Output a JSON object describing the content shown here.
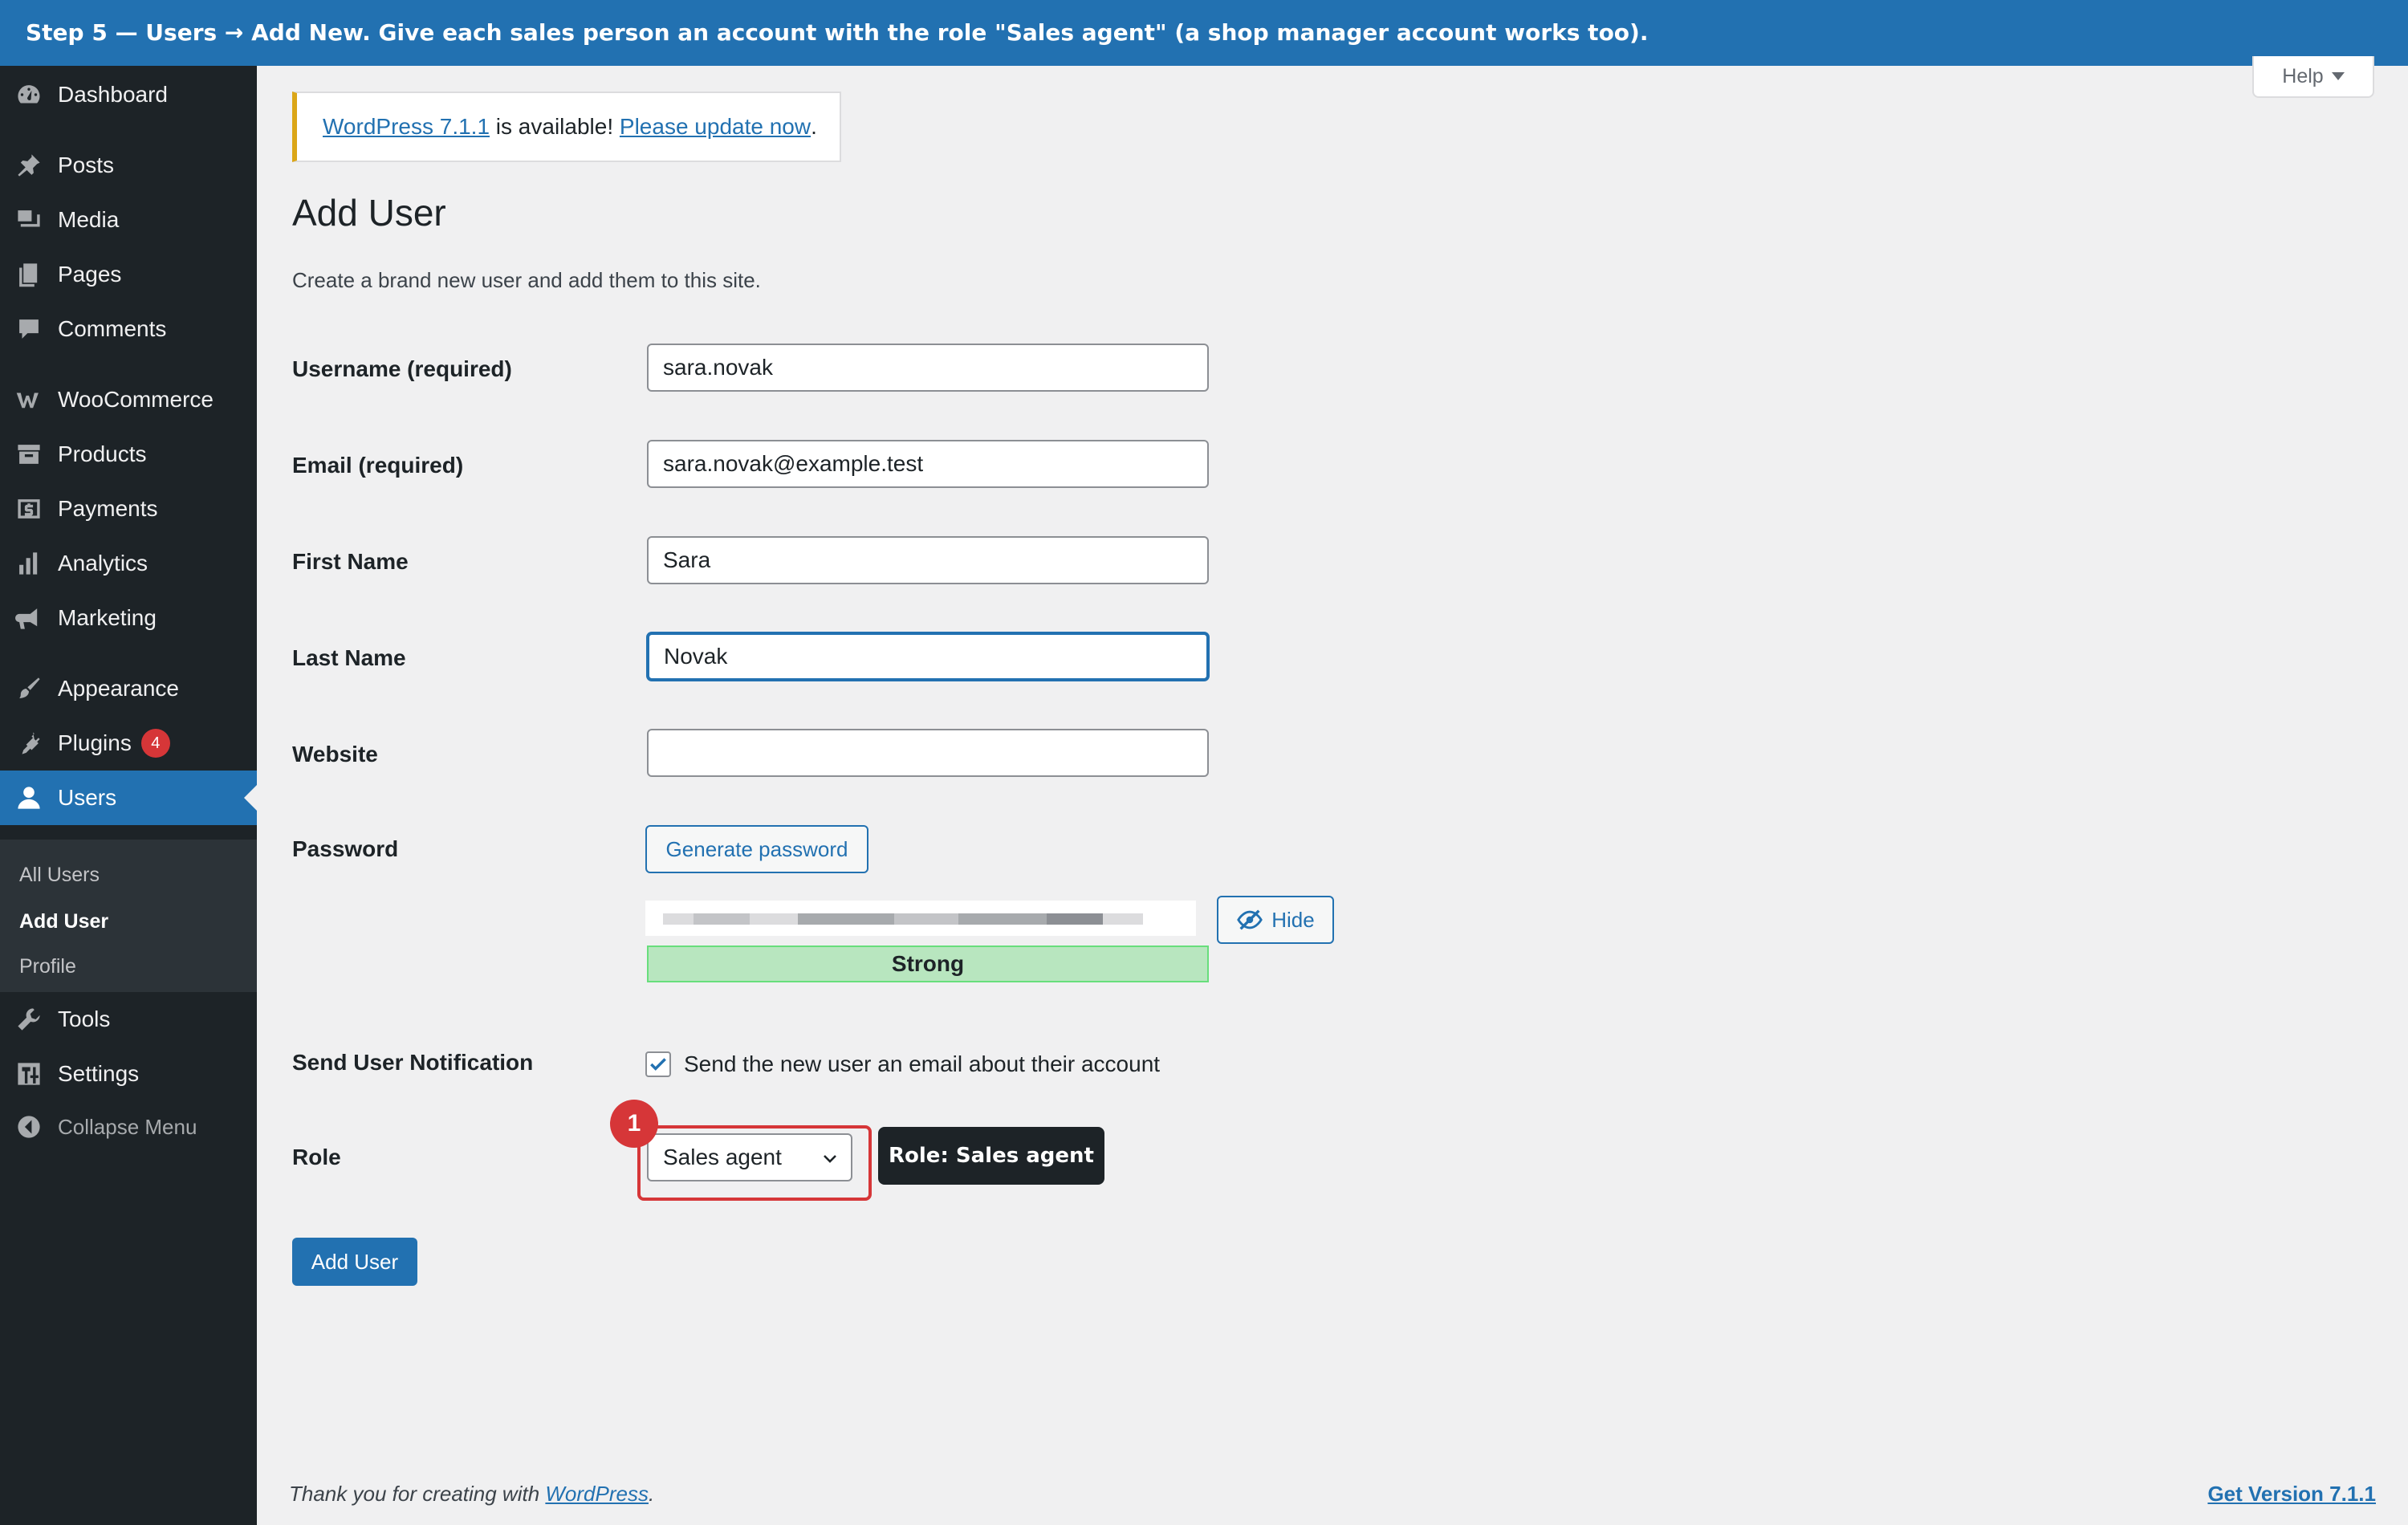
{
  "banner": {
    "text": "Step 5 — Users → Add New. Give each sales person an account with the role \"Sales agent\" (a shop manager account works too)."
  },
  "sidebar": {
    "items": [
      {
        "label": "Dashboard",
        "icon": "dashboard-icon"
      },
      {
        "label": "Posts",
        "icon": "pin-icon"
      },
      {
        "label": "Media",
        "icon": "media-icon"
      },
      {
        "label": "Pages",
        "icon": "pages-icon"
      },
      {
        "label": "Comments",
        "icon": "comment-icon"
      },
      {
        "label": "WooCommerce",
        "icon": "woocommerce-icon"
      },
      {
        "label": "Products",
        "icon": "archive-icon"
      },
      {
        "label": "Payments",
        "icon": "dollar-icon"
      },
      {
        "label": "Analytics",
        "icon": "bar-chart-icon"
      },
      {
        "label": "Marketing",
        "icon": "megaphone-icon"
      },
      {
        "label": "Appearance",
        "icon": "brush-icon"
      },
      {
        "label": "Plugins",
        "icon": "plug-icon",
        "badge": "4"
      },
      {
        "label": "Users",
        "icon": "user-icon",
        "active": true
      },
      {
        "label": "Tools",
        "icon": "wrench-icon"
      },
      {
        "label": "Settings",
        "icon": "settings-icon"
      }
    ],
    "submenu": [
      "All Users",
      "Add User",
      "Profile"
    ],
    "collapse_label": "Collapse Menu"
  },
  "help": {
    "label": "Help"
  },
  "notice": {
    "version_link": "WordPress 7.1.1",
    "middle_text": " is available! ",
    "update_link": "Please update now",
    "end_text": "."
  },
  "page": {
    "title": "Add User",
    "description": "Create a brand new user and add them to this site."
  },
  "form": {
    "username": {
      "label": "Username (required)",
      "value": "sara.novak"
    },
    "email": {
      "label": "Email (required)",
      "value": "sara.novak@example.test"
    },
    "first_name": {
      "label": "First Name",
      "value": "Sara"
    },
    "last_name": {
      "label": "Last Name",
      "value": "Novak"
    },
    "website": {
      "label": "Website",
      "value": ""
    },
    "password": {
      "label": "Password",
      "generate_label": "Generate password",
      "hide_label": "Hide",
      "strength": "Strong"
    },
    "notification": {
      "label": "Send User Notification",
      "checkbox_label": "Send the new user an email about their account",
      "checked": true
    },
    "role": {
      "label": "Role",
      "value": "Sales agent"
    },
    "submit_label": "Add User"
  },
  "annotation": {
    "step_number": "1",
    "tooltip": "Role: Sales agent",
    "highlight_color": "#d63638"
  },
  "footer": {
    "thanks_text": "Thank you for creating with ",
    "wp_link": "WordPress",
    "thanks_end": ".",
    "version_link": "Get Version 7.1.1"
  },
  "colors": {
    "accent": "#2271b1",
    "sidebar_bg": "#1d2327",
    "warning": "#dba617",
    "danger": "#d63638",
    "strength_bg": "#b8e6bf"
  }
}
